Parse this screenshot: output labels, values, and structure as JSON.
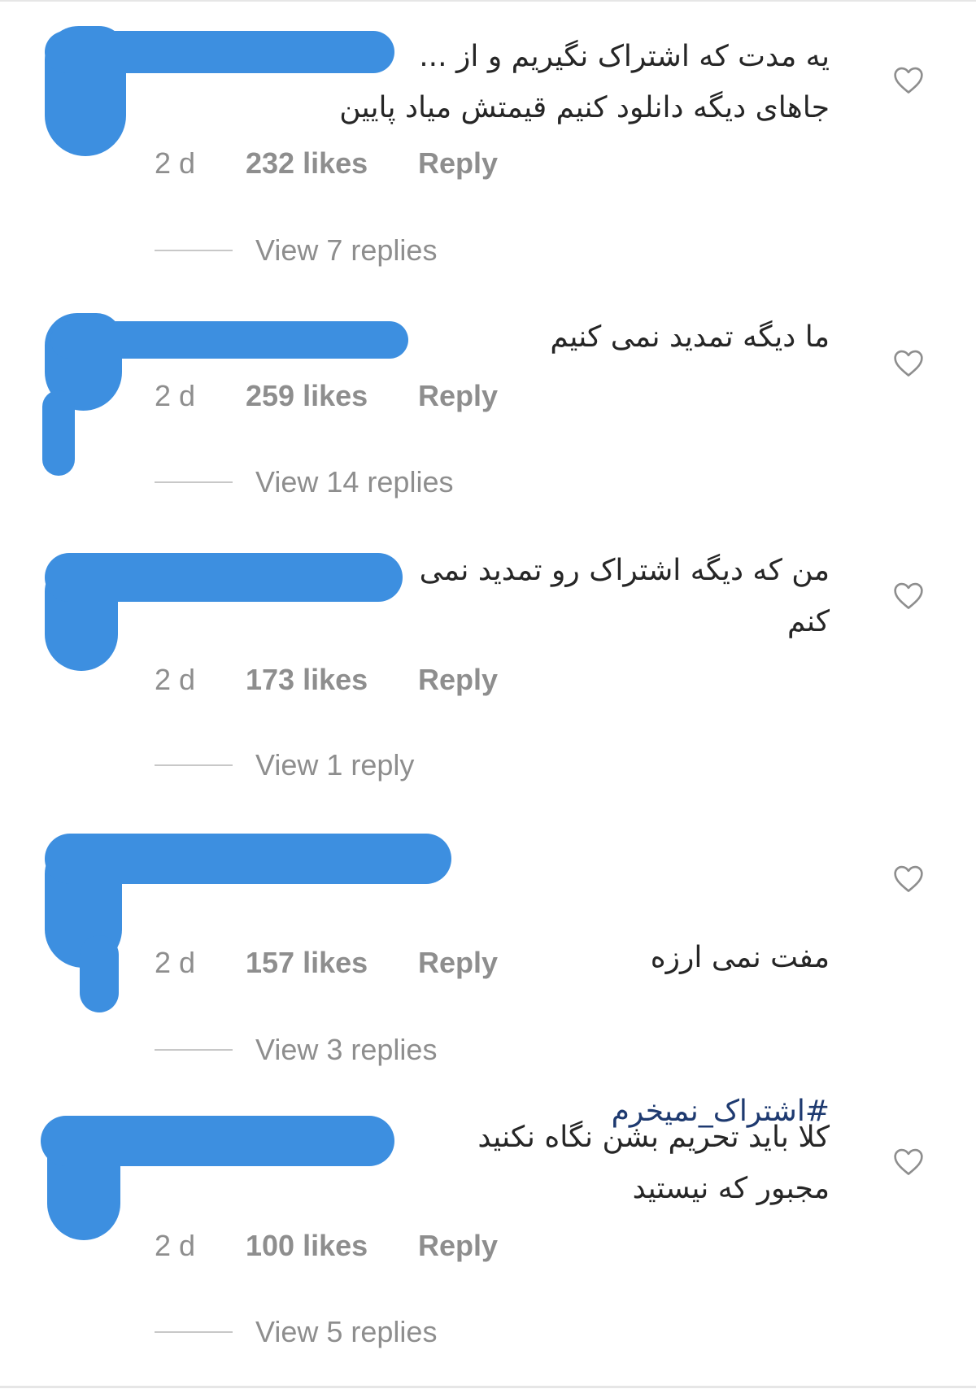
{
  "comments": [
    {
      "text": "یه مدت که اشتراک نگیریم و از ...\nجاهای دیگه دانلود کنیم قیمتش میاد پایین",
      "time": "2 d",
      "likes": "232 likes",
      "reply_label": "Reply",
      "view_replies": "View 7 replies"
    },
    {
      "text": "ما دیگه تمدید نمی کنیم",
      "time": "2 d",
      "likes": "259 likes",
      "reply_label": "Reply",
      "view_replies": "View 14 replies"
    },
    {
      "text": "من که دیگه اشتراک رو تمدید نمی\nکنم",
      "time": "2 d",
      "likes": "173 likes",
      "reply_label": "Reply",
      "view_replies": "View 1 reply"
    },
    {
      "text": "مفت نمی ارزه",
      "hashtag": "#اشتراک_نمیخرم",
      "time": "2 d",
      "likes": "157 likes",
      "reply_label": "Reply",
      "view_replies": "View 3 replies"
    },
    {
      "text": "کلا باید تحریم بشن نگاه نکنید\nمجبور که نیستید",
      "time": "2 d",
      "likes": "100 likes",
      "reply_label": "Reply",
      "view_replies": "View 5 replies"
    }
  ],
  "icons": {
    "like": "heart-outline-icon"
  },
  "colors": {
    "redaction": "#3d8fe0",
    "meta_text": "#8e8e8e",
    "comment_text": "#262626",
    "hashtag": "#1e3a70"
  }
}
